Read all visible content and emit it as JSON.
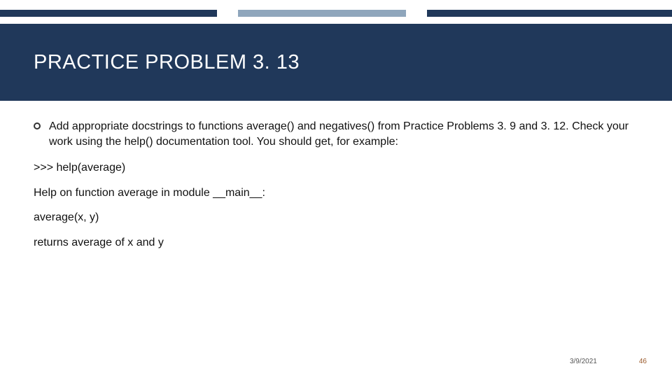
{
  "title": "PRACTICE PROBLEM 3. 13",
  "bullet": "Add appropriate docstrings to functions average() and negatives() from Practice Problems 3. 9 and 3. 12. Check your work using the help() documentation tool. You should get, for example:",
  "lines": {
    "repl": ">>> help(average)",
    "help_header": "Help on function average in module __main__:",
    "signature": "average(x, y)",
    "desc": "returns average of x and y"
  },
  "footer": {
    "date": "3/9/2021",
    "page": "46"
  }
}
